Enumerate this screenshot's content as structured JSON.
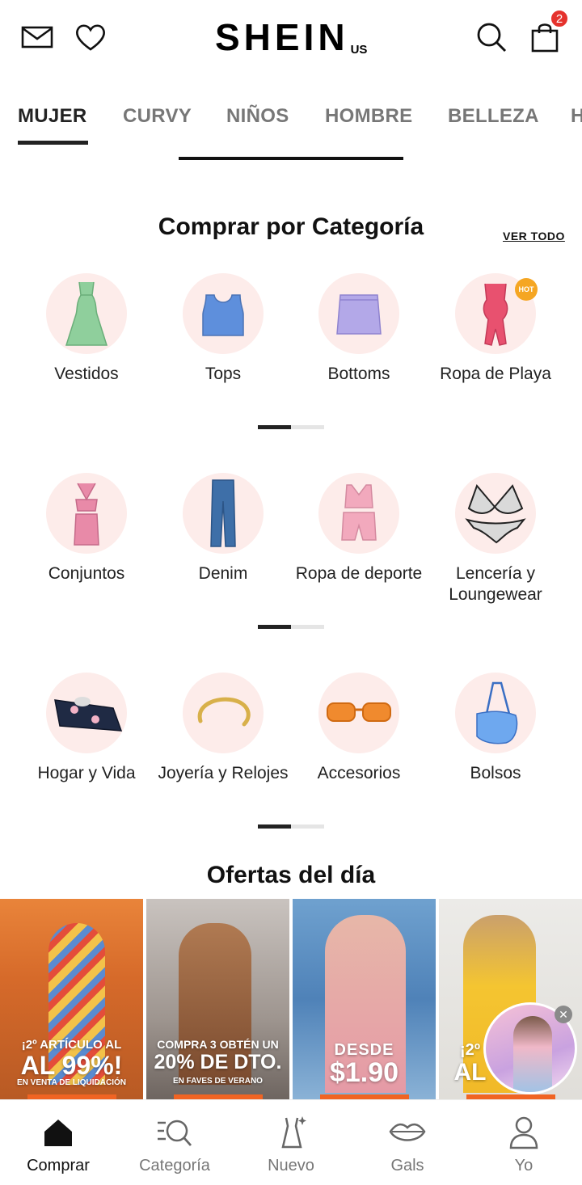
{
  "header": {
    "logo": "SHEIN",
    "logo_region": "US",
    "cart_count": "2"
  },
  "tabs": [
    {
      "label": "MUJER",
      "active": true
    },
    {
      "label": "CURVY",
      "active": false
    },
    {
      "label": "NIÑOS",
      "active": false
    },
    {
      "label": "HOMBRE",
      "active": false
    },
    {
      "label": "BELLEZA",
      "active": false
    },
    {
      "label": "H",
      "active": false
    }
  ],
  "categories_section": {
    "title": "Comprar por Categoría",
    "see_all": "VER TODO",
    "hot_badge": "HOT",
    "items": [
      {
        "label": "Vestidos",
        "icon": "dress-icon"
      },
      {
        "label": "Tops",
        "icon": "top-icon"
      },
      {
        "label": "Bottoms",
        "icon": "skirt-icon"
      },
      {
        "label": "Ropa de Playa",
        "icon": "swimsuit-icon"
      },
      {
        "label": "Conjuntos",
        "icon": "set-icon"
      },
      {
        "label": "Denim",
        "icon": "jeans-icon"
      },
      {
        "label": "Ropa de deporte",
        "icon": "sportswear-icon"
      },
      {
        "label": "Lencería y Loungewear",
        "icon": "lingerie-icon"
      },
      {
        "label": "Hogar y Vida",
        "icon": "blanket-icon"
      },
      {
        "label": "Joyería y Relojes",
        "icon": "bracelet-icon"
      },
      {
        "label": "Accesorios",
        "icon": "sunglasses-icon"
      },
      {
        "label": "Bolsos",
        "icon": "bag-icon"
      }
    ]
  },
  "deals": {
    "title": "Ofertas del día",
    "cards": [
      {
        "line1": "¡2º ARTÍCULO AL",
        "line2": "AL 99%!",
        "line3": "EN VENTA DE LIQUIDACIÓN"
      },
      {
        "line1": "COMPRA 3 OBTÉN UN",
        "line2": "20% DE DTO.",
        "line3": "EN FAVES DE VERANO"
      },
      {
        "line1": "DESDE",
        "line2": "$1.90",
        "line3": ""
      },
      {
        "line1": "¡2º",
        "line2": "AL",
        "line3": ""
      }
    ]
  },
  "bottom_nav": [
    {
      "label": "Comprar",
      "icon": "home-icon",
      "active": true
    },
    {
      "label": "Categoría",
      "icon": "category-search-icon",
      "active": false
    },
    {
      "label": "Nuevo",
      "icon": "new-dress-icon",
      "active": false
    },
    {
      "label": "Gals",
      "icon": "lips-icon",
      "active": false
    },
    {
      "label": "Yo",
      "icon": "user-icon",
      "active": false
    }
  ],
  "colors": {
    "accent": "#f06423",
    "badge": "#e5322d",
    "circle_bg": "#fdecea"
  }
}
